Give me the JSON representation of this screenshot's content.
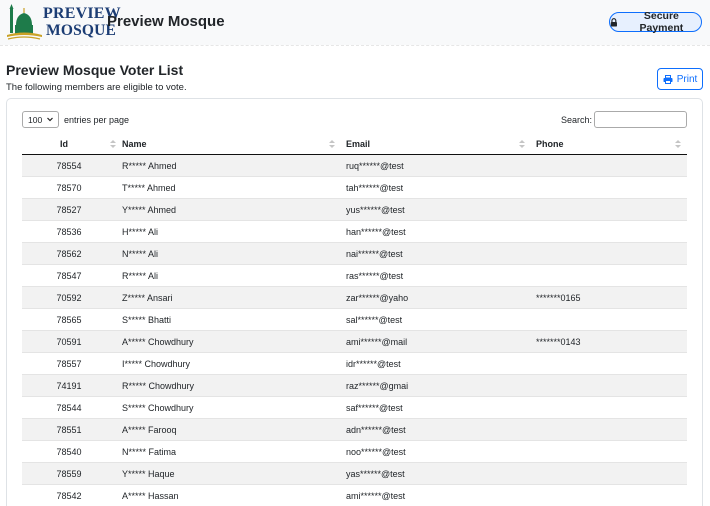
{
  "header": {
    "logo_line1": "PREVIEW",
    "logo_line2": "MOSQUE",
    "brand": "Preview Mosque",
    "secure_payment_label": "Secure Payment"
  },
  "page": {
    "title": "Preview Mosque Voter List",
    "subtitle": "The following members are eligible to vote.",
    "print_label": "Print"
  },
  "table_controls": {
    "page_length": "100",
    "entries_label": "entries per page",
    "search_label": "Search:",
    "search_value": ""
  },
  "table": {
    "columns": [
      "Id",
      "Name",
      "Email",
      "Phone"
    ],
    "rows": [
      {
        "id": "78554",
        "name": "R***** Ahmed",
        "email": "ruq******@test",
        "phone": ""
      },
      {
        "id": "78570",
        "name": "T***** Ahmed",
        "email": "tah******@test",
        "phone": ""
      },
      {
        "id": "78527",
        "name": "Y***** Ahmed",
        "email": "yus******@test",
        "phone": ""
      },
      {
        "id": "78536",
        "name": "H***** Ali",
        "email": "han******@test",
        "phone": ""
      },
      {
        "id": "78562",
        "name": "N***** Ali",
        "email": "nai******@test",
        "phone": ""
      },
      {
        "id": "78547",
        "name": "R***** Ali",
        "email": "ras******@test",
        "phone": ""
      },
      {
        "id": "70592",
        "name": "Z***** Ansari",
        "email": "zar******@yaho",
        "phone": "*******0165"
      },
      {
        "id": "78565",
        "name": "S***** Bhatti",
        "email": "sal******@test",
        "phone": ""
      },
      {
        "id": "70591",
        "name": "A***** Chowdhury",
        "email": "ami******@mail",
        "phone": "*******0143"
      },
      {
        "id": "78557",
        "name": "I***** Chowdhury",
        "email": "idr******@test",
        "phone": ""
      },
      {
        "id": "74191",
        "name": "R***** Chowdhury",
        "email": "raz******@gmai",
        "phone": ""
      },
      {
        "id": "78544",
        "name": "S***** Chowdhury",
        "email": "saf******@test",
        "phone": ""
      },
      {
        "id": "78551",
        "name": "A***** Farooq",
        "email": "adn******@test",
        "phone": ""
      },
      {
        "id": "78540",
        "name": "N***** Fatima",
        "email": "noo******@test",
        "phone": ""
      },
      {
        "id": "78559",
        "name": "Y***** Haque",
        "email": "yas******@test",
        "phone": ""
      },
      {
        "id": "78542",
        "name": "A***** Hassan",
        "email": "ami******@test",
        "phone": ""
      }
    ]
  },
  "colors": {
    "primary": "#0d6efd",
    "logo_blue": "#1c3d74",
    "logo_gold": "#c9a227",
    "logo_green": "#1e7b4a",
    "row_stripe": "#f2f2f2"
  },
  "icons": {
    "logo": "mosque-logo-icon",
    "payment": "lock-icon",
    "print": "printer-icon",
    "select": "chevron-down-icon",
    "sort": "sort-icon"
  }
}
